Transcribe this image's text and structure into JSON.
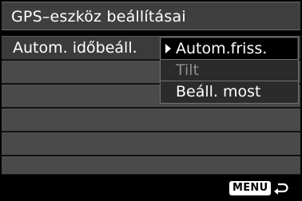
{
  "title": "GPS–eszköz beállításai",
  "rows": [
    {
      "label": "Autom. időbeáll."
    }
  ],
  "dropdown": {
    "options": [
      "Autom.friss.",
      "Tilt",
      "Beáll. most"
    ],
    "selected_index": 0
  },
  "footer": {
    "menu_label": "MENU",
    "back_icon": "return-arrow-icon"
  }
}
